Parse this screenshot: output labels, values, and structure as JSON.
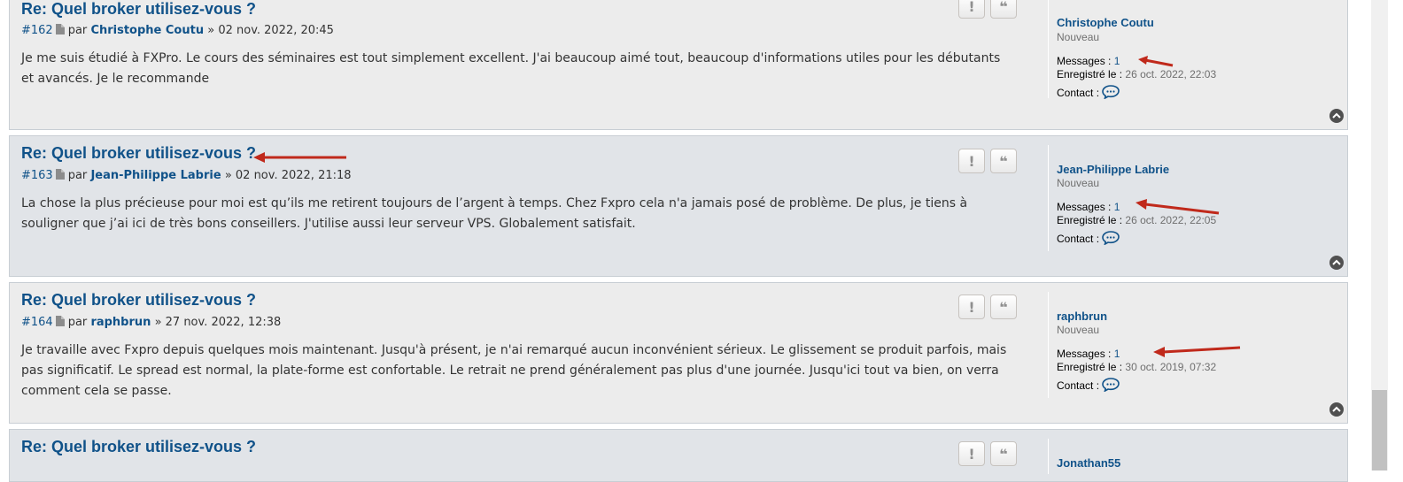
{
  "colors": {
    "accent": "#105289",
    "annotation_arrow": "#c0291b"
  },
  "posts": [
    {
      "title": "Re: Quel broker utilisez-vous ?",
      "number": "#162",
      "par": "par",
      "author": "Christophe Coutu",
      "datetime": "» 02 nov. 2022, 20:45",
      "content": "Je me suis étudié à FXPro. Le cours des séminaires est tout simplement excellent. J'ai beaucoup aimé tout, beaucoup d'informations utiles pour les débutants et avancés. Je le recommande",
      "profile": {
        "name": "Christophe Coutu",
        "rank": "Nouveau",
        "messages_label": "Messages :",
        "messages_value": "1",
        "registered_label": "Enregistré le :",
        "registered_value": "26 oct. 2022, 22:03",
        "contact_label": "Contact :"
      }
    },
    {
      "title": "Re: Quel broker utilisez-vous ?",
      "number": "#163",
      "par": "par",
      "author": "Jean-Philippe Labrie",
      "datetime": "» 02 nov. 2022, 21:18",
      "content": "La chose la plus précieuse pour moi est qu’ils me retirent toujours de l’argent à temps. Chez Fxpro cela n'a jamais posé de problème. De plus, je tiens à souligner que j’ai ici de très bons conseillers. J'utilise aussi leur serveur VPS. Globalement satisfait.",
      "profile": {
        "name": "Jean-Philippe Labrie",
        "rank": "Nouveau",
        "messages_label": "Messages :",
        "messages_value": "1",
        "registered_label": "Enregistré le :",
        "registered_value": "26 oct. 2022, 22:05",
        "contact_label": "Contact :"
      }
    },
    {
      "title": "Re: Quel broker utilisez-vous ?",
      "number": "#164",
      "par": "par",
      "author": "raphbrun",
      "datetime": "» 27 nov. 2022, 12:38",
      "content": "Je travaille avec Fxpro depuis quelques mois maintenant. Jusqu'à présent, je n'ai remarqué aucun inconvénient sérieux. Le glissement se produit parfois, mais pas significatif. Le spread est normal, la plate-forme est confortable. Le retrait ne prend généralement pas plus d'une journée. Jusqu'ici tout va bien, on verra comment cela se passe.",
      "profile": {
        "name": "raphbrun",
        "rank": "Nouveau",
        "messages_label": "Messages :",
        "messages_value": "1",
        "registered_label": "Enregistré le :",
        "registered_value": "30 oct. 2019, 07:32",
        "contact_label": "Contact :"
      }
    },
    {
      "title": "Re: Quel broker utilisez-vous ?",
      "profile": {
        "name": "Jonathan55"
      }
    }
  ],
  "buttons": {
    "report_glyph": "!",
    "quote_glyph": "❝"
  }
}
